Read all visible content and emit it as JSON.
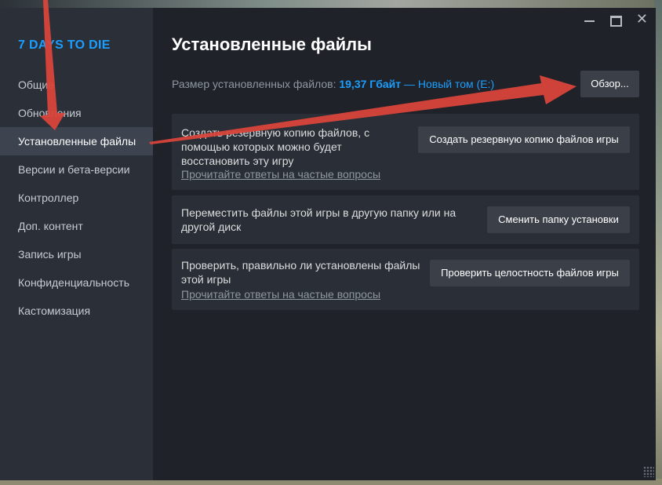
{
  "sidebar": {
    "game_title": "7 DAYS TO DIE",
    "items": [
      {
        "label": "Общие",
        "active": false
      },
      {
        "label": "Обновления",
        "active": false
      },
      {
        "label": "Установленные файлы",
        "active": true
      },
      {
        "label": "Версии и бета-версии",
        "active": false
      },
      {
        "label": "Контроллер",
        "active": false
      },
      {
        "label": "Доп. контент",
        "active": false
      },
      {
        "label": "Запись игры",
        "active": false
      },
      {
        "label": "Конфиденциальность",
        "active": false
      },
      {
        "label": "Кастомизация",
        "active": false
      }
    ]
  },
  "main": {
    "title": "Установленные файлы",
    "size_label": "Размер установленных файлов:",
    "size_value": "19,37 Гбайт",
    "size_drive": "— Новый том (E:)",
    "browse_button": "Обзор...",
    "sections": [
      {
        "text_lines": [
          "Создать резервную копию файлов, с",
          "помощью которых можно будет",
          "восстановить эту игру"
        ],
        "link": "Прочитайте ответы на частые вопросы",
        "button": "Создать резервную копию файлов игры"
      },
      {
        "text_lines": [
          "Переместить файлы этой игры в другую папку или на",
          "другой диск"
        ],
        "link": "",
        "button": "Сменить папку установки"
      },
      {
        "text_lines": [
          "Проверить, правильно ли установлены файлы",
          "этой игры"
        ],
        "link": "Прочитайте ответы на частые вопросы",
        "button": "Проверить целостность файлов игры"
      }
    ]
  },
  "colors": {
    "accent": "#1a9fff",
    "annotation_arrow": "#d9453b"
  }
}
